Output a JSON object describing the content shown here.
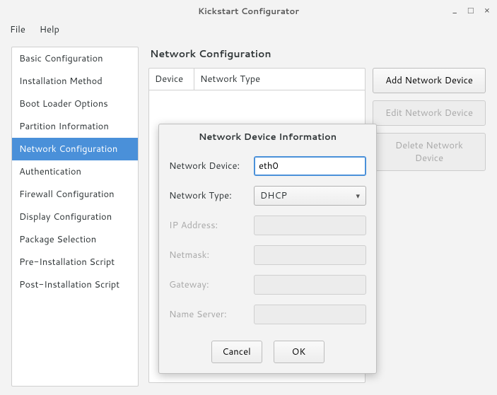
{
  "window": {
    "title": "Kickstart Configurator"
  },
  "menubar": {
    "file": "File",
    "help": "Help"
  },
  "sidebar": {
    "items": [
      {
        "label": "Basic Configuration"
      },
      {
        "label": "Installation Method"
      },
      {
        "label": "Boot Loader Options"
      },
      {
        "label": "Partition Information"
      },
      {
        "label": "Network Configuration"
      },
      {
        "label": "Authentication"
      },
      {
        "label": "Firewall Configuration"
      },
      {
        "label": "Display Configuration"
      },
      {
        "label": "Package Selection"
      },
      {
        "label": "Pre-Installation Script"
      },
      {
        "label": "Post-Installation Script"
      }
    ],
    "selected_index": 4
  },
  "main": {
    "heading": "Network Configuration",
    "table": {
      "columns": [
        "Device",
        "Network Type"
      ]
    },
    "buttons": {
      "add": "Add Network Device",
      "edit": "Edit Network Device",
      "delete": "Delete Network Device"
    }
  },
  "dialog": {
    "title": "Network Device Information",
    "labels": {
      "device": "Network Device:",
      "type": "Network Type:",
      "ip": "IP Address:",
      "netmask": "Netmask:",
      "gateway": "Gateway:",
      "nameserver": "Name Server:"
    },
    "values": {
      "device": "eth0",
      "type": "DHCP",
      "ip": "",
      "netmask": "",
      "gateway": "",
      "nameserver": ""
    },
    "actions": {
      "cancel": "Cancel",
      "ok": "OK"
    }
  }
}
